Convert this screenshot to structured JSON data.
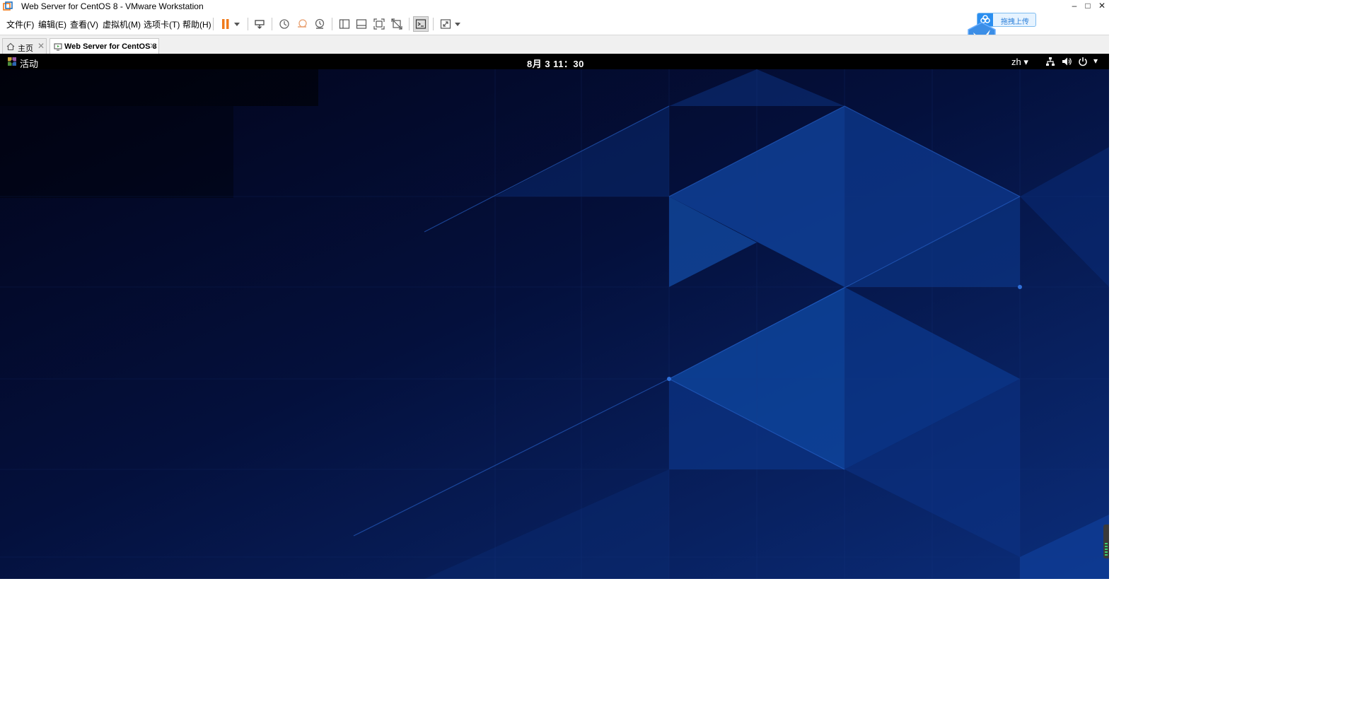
{
  "window": {
    "title": "Web Server for CentOS 8 - VMware Workstation",
    "controls": {
      "minimize": "–",
      "maximize": "□",
      "close": "✕"
    }
  },
  "menu": {
    "items": [
      "文件(F)",
      "编辑(E)",
      "查看(V)",
      "虚拟机(M)",
      "选项卡(T)",
      "帮助(H)"
    ]
  },
  "toolbar": {
    "icons": [
      "pause-icon",
      "send-ctrl-alt-del-icon",
      "snapshot-icon",
      "revert-snapshot-icon",
      "snapshot-manager-icon",
      "library-view-icon",
      "thumbnail-bar-icon",
      "full-screen-icon",
      "unity-icon",
      "console-view-icon",
      "stretch-guest-icon"
    ],
    "accent": "#f07a1a"
  },
  "upload_widget": {
    "label": "拖拽上传",
    "color": "#2a8ef0"
  },
  "tabs": [
    {
      "label": "主页",
      "icon": "home-icon",
      "close": "✕"
    },
    {
      "label": "Web Server for CentOS 8",
      "icon": "vm-icon",
      "close": "✕",
      "active": true
    }
  ],
  "gnome": {
    "activities": "活动",
    "clock": "8月 3  11：30",
    "lang": "zh ▾",
    "status_icons": [
      "network-icon",
      "volume-icon",
      "power-icon",
      "menu-arrow-icon"
    ],
    "menu_arrow": "▾"
  },
  "wallpaper": {
    "dark": "#02061e",
    "mid": "#0a1f5c",
    "bright": "#0f4aa6"
  }
}
